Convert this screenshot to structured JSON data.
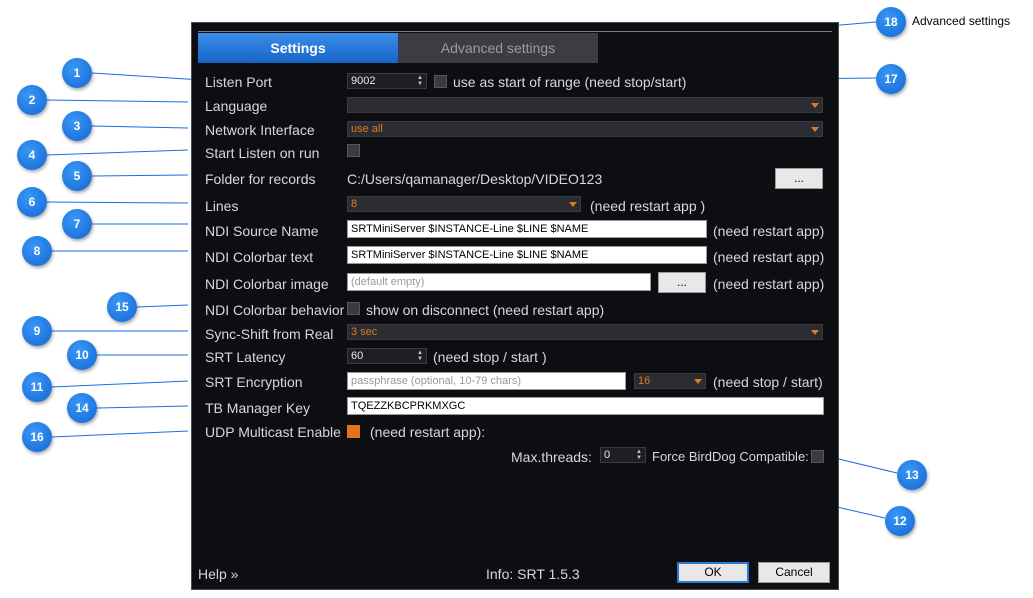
{
  "tabs": {
    "settings": "Settings",
    "advanced": "Advanced settings"
  },
  "fields": {
    "listen_port": {
      "label": "Listen Port",
      "value": "9002",
      "range_text": "use as start of range (need stop/start)"
    },
    "language": {
      "label": "Language",
      "value": ""
    },
    "network_interface": {
      "label": "Network Interface",
      "value": "use all"
    },
    "start_listen": {
      "label": "Start Listen on run"
    },
    "folder_records": {
      "label": "Folder for records",
      "value": "C:/Users/qamanager/Desktop/VIDEO123",
      "browse": "..."
    },
    "lines": {
      "label": "Lines",
      "value": "8",
      "note": "(need restart app )"
    },
    "ndi_source_name": {
      "label": "NDI Source Name",
      "value": "SRTMiniServer $INSTANCE-Line $LINE $NAME",
      "note": "(need restart app)"
    },
    "ndi_colorbar_text": {
      "label": "NDI Colorbar text",
      "value": "SRTMiniServer $INSTANCE-Line $LINE $NAME",
      "note": "(need restart app)"
    },
    "ndi_colorbar_image": {
      "label": "NDI Colorbar image",
      "placeholder": "(default empty)",
      "browse": "...",
      "note": "(need restart app)"
    },
    "ndi_colorbar_behavior": {
      "label": "NDI Colorbar behavior",
      "text": "show on disconnect (need restart app)"
    },
    "sync_shift": {
      "label": "Sync-Shift from Real",
      "value": "3 sec"
    },
    "srt_latency": {
      "label": "SRT Latency",
      "value": "60",
      "note": "(need stop / start )"
    },
    "srt_encryption": {
      "label": "SRT Encryption",
      "placeholder": "passphrase (optional, 10-79 chars)",
      "value": "16",
      "note": "(need stop / start)"
    },
    "tb_manager_key": {
      "label": "TB Manager Key",
      "value": "TQEZZKBCPRKMXGC"
    },
    "udp_multicast": {
      "label": "UDP Multicast Enable",
      "note": "(need restart app):"
    },
    "max_threads": {
      "label": "Max.threads:",
      "value": "0"
    },
    "force_birddog": {
      "label": "Force BirdDog Compatible:"
    }
  },
  "footer": {
    "help": "Help »",
    "info": "Info: SRT 1.5.3",
    "ok": "OK",
    "cancel": "Cancel"
  },
  "callouts": {
    "c1": "1",
    "c2": "2",
    "c3": "3",
    "c4": "4",
    "c5": "5",
    "c6": "6",
    "c7": "7",
    "c8": "8",
    "c9": "9",
    "c10": "10",
    "c11": "11",
    "c12": "12",
    "c13": "13",
    "c14": "14",
    "c15": "15",
    "c16": "16",
    "c17": "17",
    "c18": "18"
  },
  "callout_label_18": "Advanced settings",
  "colors": {
    "accent": "#e8721c",
    "tab_active": "#1f73d6",
    "dialog_bg": "#0d0e12",
    "callout": "#1a6fdc"
  }
}
